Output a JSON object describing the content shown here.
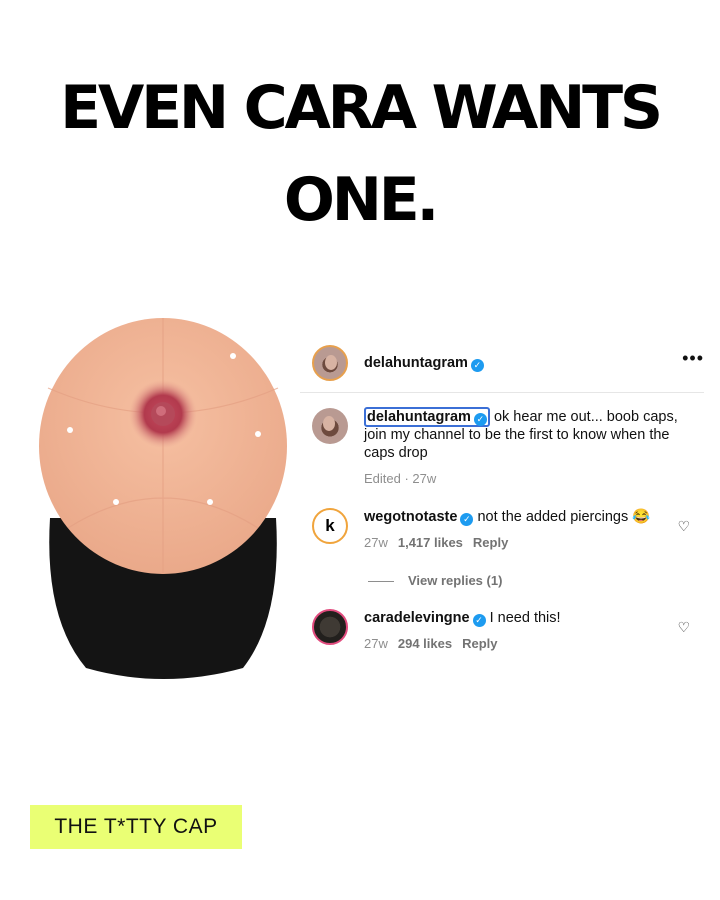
{
  "headline": {
    "line1": "EVEN CARA WANTS",
    "line2": "ONE."
  },
  "post": {
    "author": "delahuntagram",
    "caption_author": "delahuntagram",
    "caption_text": "ok hear me out... boob caps, join my channel to be the first to know when the caps drop",
    "caption_meta": "Edited · 27w",
    "comments": [
      {
        "user": "wegotnotaste",
        "text": "not the added piercings 😂",
        "age": "27w",
        "likes": "1,417 likes",
        "reply": "Reply"
      },
      {
        "user": "caradelevingne",
        "text": "I need this!",
        "age": "27w",
        "likes": "294 likes",
        "reply": "Reply"
      }
    ],
    "view_replies": "View replies (1)"
  },
  "brand_tag": "THE T*TTY CAP",
  "colors": {
    "tag_bg": "#eaff74",
    "verified": "#1d9bf0",
    "cap_crown": "#f3b596",
    "cap_brim": "#141414",
    "nipple": "#b23a4d"
  },
  "icons": {
    "more": "more-icon",
    "heart": "heart-icon",
    "verified": "verified-badge-icon"
  }
}
